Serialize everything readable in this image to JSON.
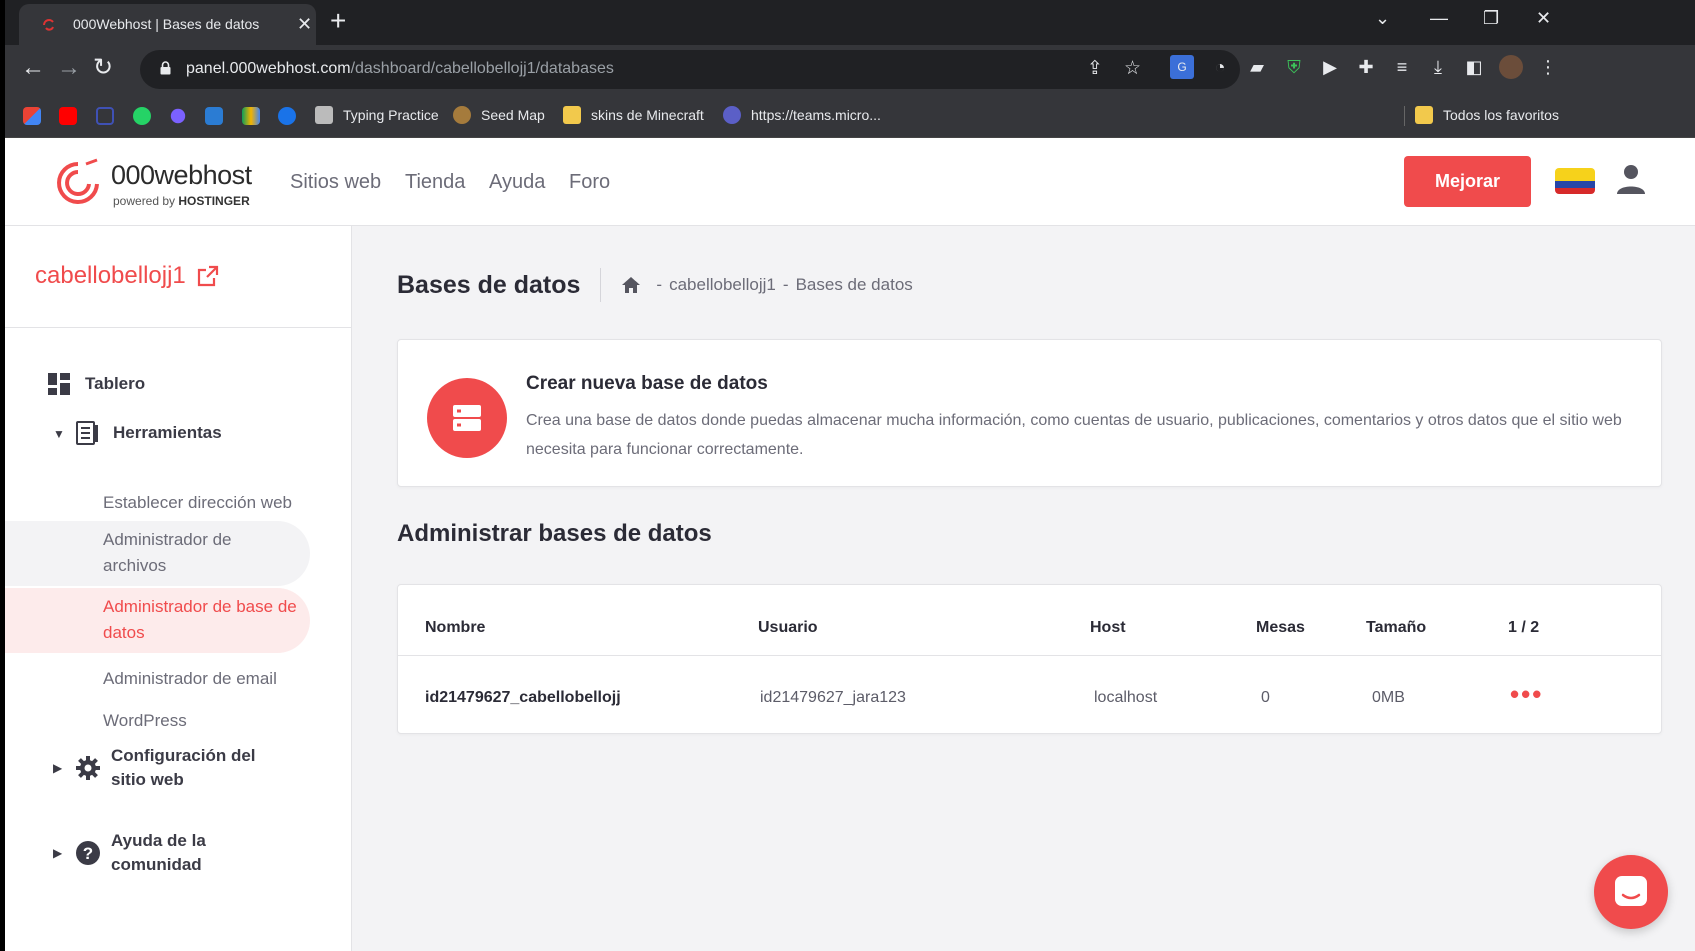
{
  "browser": {
    "tab_title": "000Webhost | Bases de datos",
    "url_host": "panel.000webhost.com",
    "url_path": "/dashboard/cabellobellojj1/databases",
    "bookmarks": [
      "Typing Practice",
      "Seed Map",
      "skins de Minecraft",
      "https://teams.micro...",
      "Todos los favoritos"
    ]
  },
  "site": {
    "logo_name": "000webhost",
    "logo_powered": "powered by",
    "logo_brand": "HOSTINGER",
    "nav": [
      "Sitios web",
      "Tienda",
      "Ayuda",
      "Foro"
    ],
    "upgrade_label": "Mejorar",
    "accent": "#f04b4c"
  },
  "sidebar": {
    "site_name": "cabellobellojj1",
    "dashboard": "Tablero",
    "tools": "Herramientas",
    "tool_items": [
      "Establecer dirección web",
      "Administrador de archivos",
      "Administrador de base de datos",
      "Administrador de email",
      "WordPress"
    ],
    "settings": "Configuración del sitio web",
    "community": "Ayuda de la comunidad"
  },
  "main": {
    "title": "Bases de datos",
    "breadcrumb": [
      "cabellobellojj1",
      "Bases de datos"
    ],
    "create": {
      "title": "Crear nueva base de datos",
      "description": "Crea una base de datos donde puedas almacenar mucha información, como cuentas de usuario, publicaciones, comentarios y otros datos que el sitio web necesita para funcionar correctamente."
    },
    "manage_title": "Administrar bases de datos",
    "table": {
      "headers": [
        "Nombre",
        "Usuario",
        "Host",
        "Mesas",
        "Tamaño",
        "1 / 2"
      ],
      "rows": [
        {
          "name": "id21479627_cabellobellojj",
          "user": "id21479627_jara123",
          "host": "localhost",
          "tables": "0",
          "size": "0MB"
        }
      ]
    }
  }
}
